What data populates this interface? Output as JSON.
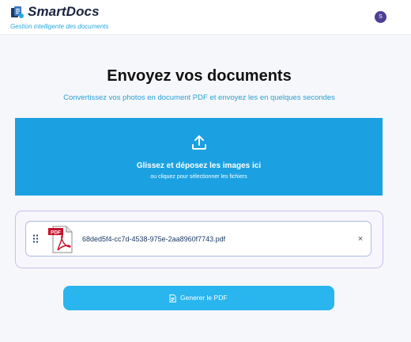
{
  "header": {
    "brand": "SmartDocs",
    "tagline": "Gestion intelligente des documents",
    "avatar_initial": "S",
    "avatar_color": "#4b3f94"
  },
  "main": {
    "title": "Envoyez vos documents",
    "subtitle": "Convertissez vos photos en document PDF et envoyez les en quelques secondes"
  },
  "dropzone": {
    "icon": "upload-icon",
    "title": "Glissez et déposez les images ici",
    "subtitle": "ou cliquez pour sélectionner les fichiers",
    "color": "#1ba1e2"
  },
  "files": [
    {
      "icon": "pdf-file-icon",
      "name": "68ded5f4-cc7d-4538-975e-2aa8960f7743.pdf",
      "remove_label": "×"
    }
  ],
  "actions": {
    "generate_label": "Generer le PDF",
    "generate_icon": "document-icon",
    "accent": "#29b5ee"
  }
}
